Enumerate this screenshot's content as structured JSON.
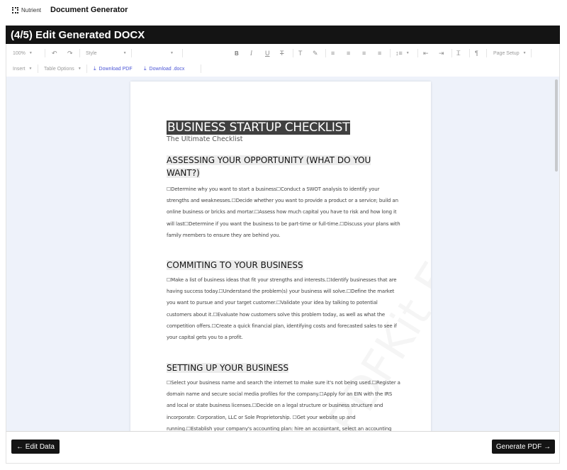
{
  "app": {
    "brand": "Nutrient",
    "title": "Document Generator"
  },
  "panel": {
    "title": "(4/5) Edit Generated DOCX"
  },
  "toolbar": {
    "zoom": "100%",
    "style": "Style",
    "font": "",
    "page_setup": "Page Setup",
    "insert": "Insert",
    "table_options": "Table Options",
    "download_pdf": "Download PDF",
    "download_docx": "Download .docx"
  },
  "document": {
    "watermark": "PSPDFKit Evaluation Copy",
    "title": "BUSINESS STARTUP CHECKLIST",
    "subtitle": "The Ultimate Checklist",
    "sections": [
      {
        "heading": "ASSESSING YOUR OPPORTUNITY (WHAT DO YOU WANT?)",
        "body": "☐Determine why you want to start a business☐Conduct a SWOT analysis to identify your strengths and weaknesses.☐Decide whether you want to provide a product or a service; build an online business or bricks and mortar.☐Assess how much capital you have to risk and how long it will last☐Determine if you want the business to be part-time or full-time.☐Discuss your plans with family members to ensure they are behind you."
      },
      {
        "heading": "COMMITING TO YOUR BUSINESS",
        "body": "☐Make a list of business ideas that fit your strengths and interests.☐Identify businesses that are having success today.☐Understand the problem(s) your business will solve.☐Define the market you want to pursue and your target customer.☐Validate your idea by talking to potential customers about it.☐Evaluate how customers solve this problem today, as well as what the competition offers.☐Create a quick financial plan, identifying costs and forecasted sales to see if your capital gets you to a profit."
      },
      {
        "heading": "SETTING UP YOUR BUSINESS",
        "body": "☐Select your business name and search the internet to make sure it's not being used.☐Register a domain name and secure social media profiles for the company.☐Apply for an EIN with the IRS and local or state business licenses.☐Decide on a legal structure or business structure and incorporate: Corporation, LLC or Sole Proprietorship. ☐Get your website up and running.☐Establish your company's accounting plan: hire an accountant, select an accounting system, and a fiscal"
      }
    ]
  },
  "footer": {
    "back_label": "← Edit Data",
    "next_label": "Generate PDF →"
  }
}
